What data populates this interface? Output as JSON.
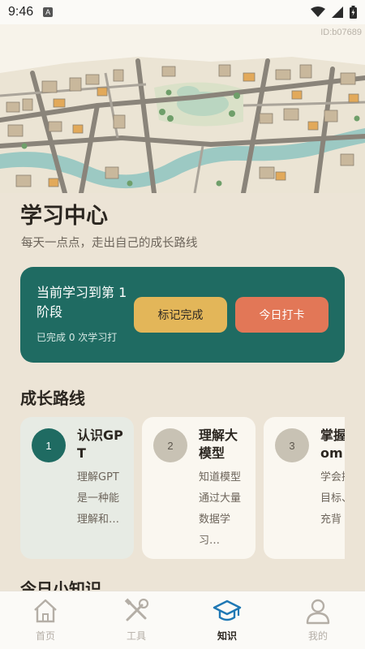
{
  "status_bar": {
    "time": "9:46",
    "notification_glyph": "A"
  },
  "hero": {
    "id_label": "ID:b07689"
  },
  "header": {
    "title": "学习中心",
    "subtitle": "每天一点点，走出自己的成长路线"
  },
  "progress": {
    "title": "当前学习到第 1 阶段",
    "sub": "已完成 0 次学习打",
    "mark_button": "标记完成",
    "checkin_button": "今日打卡"
  },
  "route": {
    "title": "成长路线",
    "steps": [
      {
        "number": "1",
        "title": "认识GPT",
        "desc": "理解GPT是一种能理解和…"
      },
      {
        "number": "2",
        "title": "理解大模型",
        "desc": "知道模型通过大量数据学习…"
      },
      {
        "number": "3",
        "title": "掌握Prom",
        "desc": "学会描述目标、补充背"
      }
    ]
  },
  "tips": {
    "title": "今日小知识"
  },
  "tabs": [
    {
      "label": "首页",
      "icon": "home-icon"
    },
    {
      "label": "工具",
      "icon": "tools-icon"
    },
    {
      "label": "知识",
      "icon": "graduation-cap-icon"
    },
    {
      "label": "我的",
      "icon": "user-icon"
    }
  ],
  "colors": {
    "primary": "#1f6b62",
    "accent_yellow": "#e3b659",
    "accent_orange": "#e27757",
    "background": "#ece4d6"
  }
}
